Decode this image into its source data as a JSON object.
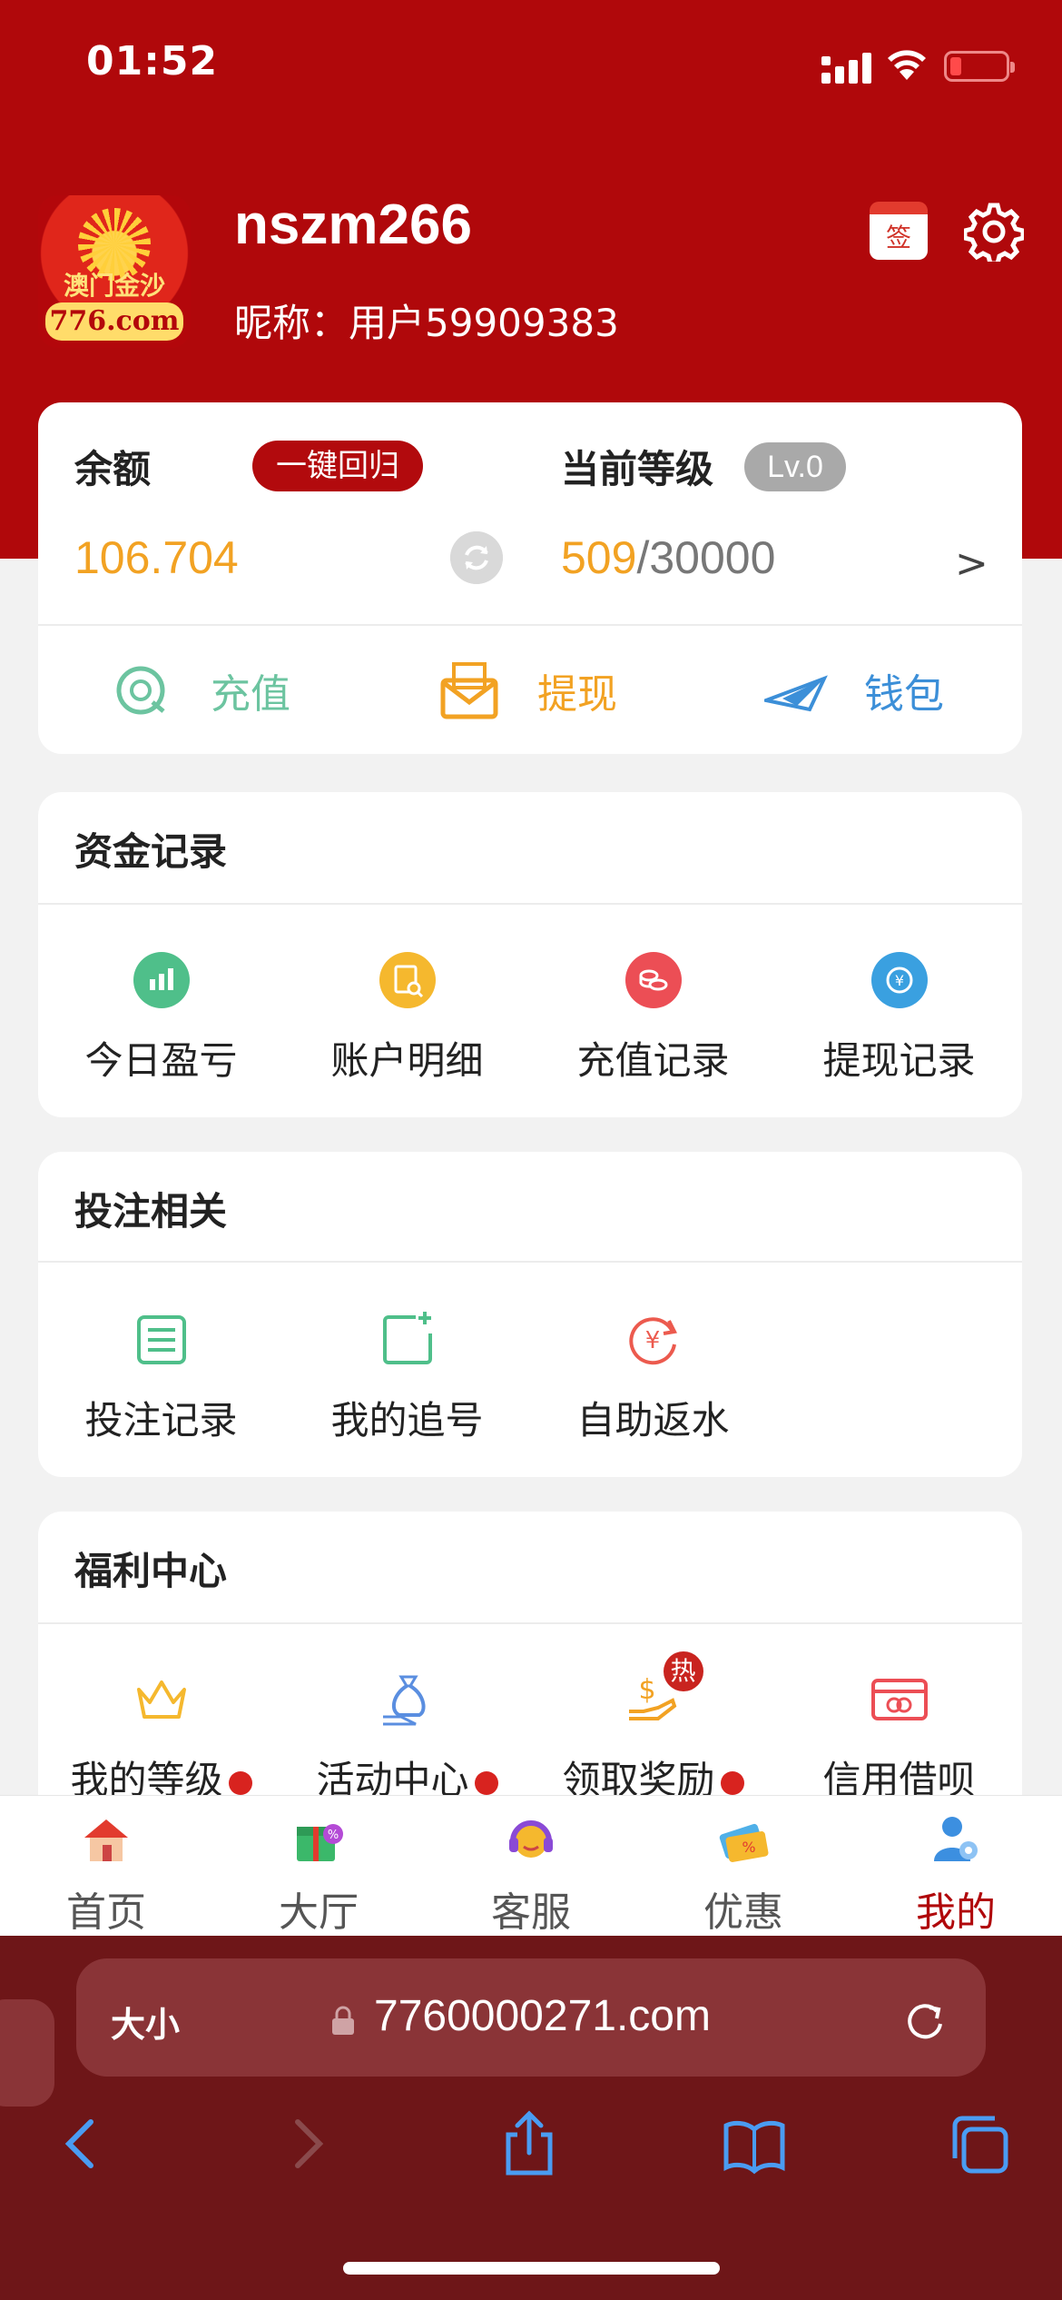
{
  "status_bar": {
    "time": "01:52"
  },
  "profile": {
    "avatar_text": "澳门金沙",
    "avatar_url_text": "776.com",
    "username": "nszm266",
    "nickname_label": "昵称：",
    "nickname_value": "用户59909383",
    "sign_label": "签"
  },
  "balance_card": {
    "balance_label": "余额",
    "recall_button": "一键回归",
    "balance_value": "106.704",
    "level_label": "当前等级",
    "level_badge": "Lv.0",
    "level_current": "509",
    "level_separator": "/",
    "level_target": "30000",
    "level_arrow": ">",
    "actions": [
      {
        "label": "充值",
        "icon": "recharge-icon",
        "color": "#6cc4a0"
      },
      {
        "label": "提现",
        "icon": "withdraw-envelope-icon",
        "color": "#f2a223"
      },
      {
        "label": "钱包",
        "icon": "wallet-plane-icon",
        "color": "#3c8fd8"
      }
    ]
  },
  "fund_records": {
    "title": "资金记录",
    "items": [
      {
        "label": "今日盈亏",
        "icon": "bar-chart-icon",
        "color": "#4fbf8a"
      },
      {
        "label": "账户明细",
        "icon": "document-search-icon",
        "color": "#f5b82e"
      },
      {
        "label": "充值记录",
        "icon": "coins-icon",
        "color": "#ec4e55"
      },
      {
        "label": "提现记录",
        "icon": "yuan-refresh-icon",
        "color": "#3aa0e0"
      }
    ]
  },
  "betting": {
    "title": "投注相关",
    "items": [
      {
        "label": "投注记录",
        "icon": "list-icon",
        "color": "#4fbf8a"
      },
      {
        "label": "我的追号",
        "icon": "add-note-icon",
        "color": "#4fbf8a"
      },
      {
        "label": "自助返水",
        "icon": "yuan-cycle-icon",
        "color": "#ec5a4e"
      }
    ]
  },
  "welfare": {
    "title": "福利中心",
    "hot_badge": "热",
    "items": [
      {
        "label": "我的等级",
        "icon": "crown-icon",
        "color": "#f5b82e",
        "dot": true
      },
      {
        "label": "活动中心",
        "icon": "money-bag-icon",
        "color": "#5a8ee0",
        "dot": true
      },
      {
        "label": "领取奖励",
        "icon": "dollar-hand-icon",
        "color": "#f2a223",
        "dot": true
      },
      {
        "label": "信用借呗",
        "icon": "card-icon",
        "color": "#ec4e55",
        "dot": false
      }
    ]
  },
  "tabbar": {
    "items": [
      {
        "label": "首页",
        "icon": "house-icon"
      },
      {
        "label": "大厅",
        "icon": "gift-icon"
      },
      {
        "label": "客服",
        "icon": "headset-icon"
      },
      {
        "label": "优惠",
        "icon": "coupon-icon"
      },
      {
        "label": "我的",
        "icon": "user-icon",
        "active": true
      }
    ]
  },
  "browser": {
    "text_size_label": "大小",
    "url": "7760000271.com"
  },
  "colors": {
    "brand_red": "#b0080b",
    "accent_orange": "#f2a223",
    "browser_bg": "#6e1618"
  }
}
